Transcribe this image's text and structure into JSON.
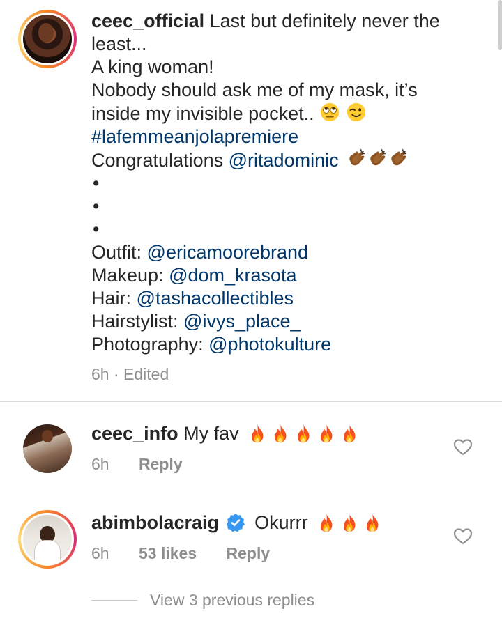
{
  "post": {
    "username": "ceec_official",
    "caption_line1": "Last but definitely never the",
    "caption_line2": "least...",
    "caption_line3": "A king woman!",
    "caption_line4": "Nobody should ask me of my mask, it’s",
    "caption_line5": "inside my invisible pocket..",
    "hashtag": "#lafemmeanjolapremiere",
    "congrats_prefix": "Congratulations",
    "congrats_mention": "@ritadominic",
    "bullet": "•",
    "credits": [
      {
        "label": "Outfit:",
        "mention": "@ericamoorebrand"
      },
      {
        "label": "Makeup:",
        "mention": "@dom_krasota"
      },
      {
        "label": "Hair:",
        "mention": "@tashacollectibles"
      },
      {
        "label": "Hairstylist:",
        "mention": "@ivys_place_"
      },
      {
        "label": "Photography:",
        "mention": "@photokulture"
      }
    ],
    "time": "6h",
    "separator": "·",
    "edited": "Edited"
  },
  "comments": [
    {
      "username": "ceec_info",
      "text": "My fav",
      "time": "6h",
      "reply_label": "Reply"
    },
    {
      "username": "abimbolacraig",
      "text": "Okurrr",
      "time": "6h",
      "likes": "53 likes",
      "reply_label": "Reply",
      "view_replies": "View 3 previous replies"
    }
  ],
  "colors": {
    "link": "#00376b",
    "meta": "#8e8e8e",
    "verified": "#3897f0"
  },
  "icons": [
    "rolling-eyes-emoji-icon",
    "winking-face-emoji-icon",
    "clapping-hands-emoji-icon",
    "fire-emoji-icon",
    "heart-outline-icon",
    "verified-badge-icon"
  ]
}
